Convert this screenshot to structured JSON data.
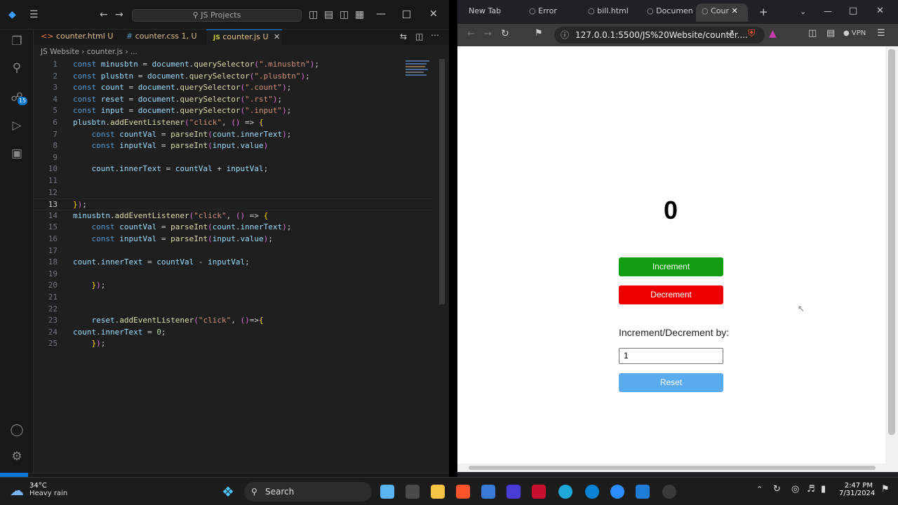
{
  "vscode": {
    "search_text": "JS Projects",
    "tabs": [
      {
        "label": "counter.html",
        "badge": "U",
        "icon": "html-icon"
      },
      {
        "label": "counter.css",
        "badge": "1, U",
        "icon": "css-icon"
      },
      {
        "label": "counter.js",
        "badge": "U",
        "icon": "js-icon"
      }
    ],
    "breadcrumb": "JS Website  ›  counter.js  ›  ...",
    "source_control_badge": "15",
    "current_line": "13",
    "code_lines": [
      "const minusbtn = document.querySelector(\".minusbtn\");",
      "const plusbtn = document.querySelector(\".plusbtn\");",
      "const count = document.querySelector(\".count\");",
      "const reset = document.querySelector(\".rst\");",
      "const input = document.querySelector(\".input\");",
      "plusbtn.addEventListener(\"click\", () => {",
      "    const countVal = parseInt(count.innerText);",
      "    const inputVal = parseInt(input.value)",
      "",
      "    count.innerText = countVal + inputVal;",
      "",
      "",
      "});",
      "minusbtn.addEventListener(\"click\", () => {",
      "    const countVal = parseInt(count.innerText);",
      "    const inputVal = parseInt(input.value);",
      "",
      "count.innerText = countVal - inputVal;",
      "",
      "    });",
      "",
      "",
      "    reset.addEventListener(\"click\", ()=>{",
      "count.innerText = 0;",
      "    });"
    ]
  },
  "browser": {
    "tabs": [
      "New Tab",
      "Error",
      "bill.html",
      "Documen",
      "Cour"
    ],
    "url": "127.0.0.1:5500/JS%20Website/counter....",
    "vpn_label": "VPN",
    "page": {
      "count": "0",
      "increment_label": "Increment",
      "decrement_label": "Decrement",
      "step_label": "Increment/Decrement by:",
      "step_value": "1",
      "reset_label": "Reset"
    },
    "colors": {
      "increment": "#109e10",
      "decrement": "#ee0000",
      "reset": "#5aabef"
    }
  },
  "taskbar": {
    "weather_temp": "34°C",
    "weather_desc": "Heavy rain",
    "search_label": "Search",
    "time": "2:47 PM",
    "date": "7/31/2024"
  }
}
